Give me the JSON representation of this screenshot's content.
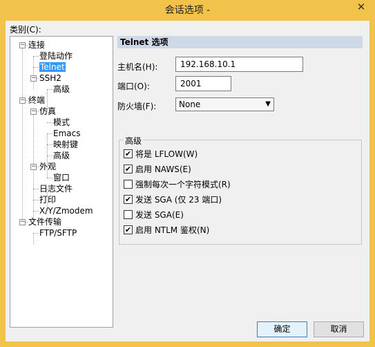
{
  "window": {
    "title": "会话选项 -",
    "close_glyph": "✕"
  },
  "category_label": "类别(C):",
  "tree": [
    {
      "label": "连接",
      "level": 0,
      "expander": "−"
    },
    {
      "label": "登陆动作",
      "level": 1
    },
    {
      "label": "Telnet",
      "level": 1,
      "selected": true
    },
    {
      "label": "SSH2",
      "level": 1,
      "expander": "−"
    },
    {
      "label": "高级",
      "level": 2
    },
    {
      "label": "终端",
      "level": 0,
      "expander": "−"
    },
    {
      "label": "仿真",
      "level": 1,
      "expander": "−"
    },
    {
      "label": "模式",
      "level": 2
    },
    {
      "label": "Emacs",
      "level": 2
    },
    {
      "label": "映射键",
      "level": 2
    },
    {
      "label": "高级",
      "level": 2
    },
    {
      "label": "外观",
      "level": 1,
      "expander": "−"
    },
    {
      "label": "窗口",
      "level": 2
    },
    {
      "label": "日志文件",
      "level": 1
    },
    {
      "label": "打印",
      "level": 1
    },
    {
      "label": "X/Y/Zmodem",
      "level": 1
    },
    {
      "label": "文件传输",
      "level": 0,
      "expander": "−"
    },
    {
      "label": "FTP/SFTP",
      "level": 1
    }
  ],
  "panel": {
    "title": "Telnet 选项",
    "hostname_label": "主机名(H):",
    "hostname_value": "192.168.10.1",
    "port_label": "端口(O):",
    "port_value": "2001",
    "firewall_label": "防火墙(F):",
    "firewall_value": "None",
    "advanced_label": "高级",
    "options": [
      {
        "label": "将是 LFLOW(W)",
        "checked": true
      },
      {
        "label": "启用 NAWS(E)",
        "checked": true
      },
      {
        "label": "强制每次一个字符模式(R)",
        "checked": false
      },
      {
        "label": "发送 SGA (仅 23 端口)",
        "checked": true
      },
      {
        "label": "发送 SGA(E)",
        "checked": false
      },
      {
        "label": "启用 NTLM 鉴权(N)",
        "checked": true
      }
    ]
  },
  "buttons": {
    "ok": "确定",
    "cancel": "取消"
  },
  "colors": {
    "titlebar": "#f2c34a",
    "section_header": "#cfd8e6",
    "selection": "#3399ff"
  }
}
